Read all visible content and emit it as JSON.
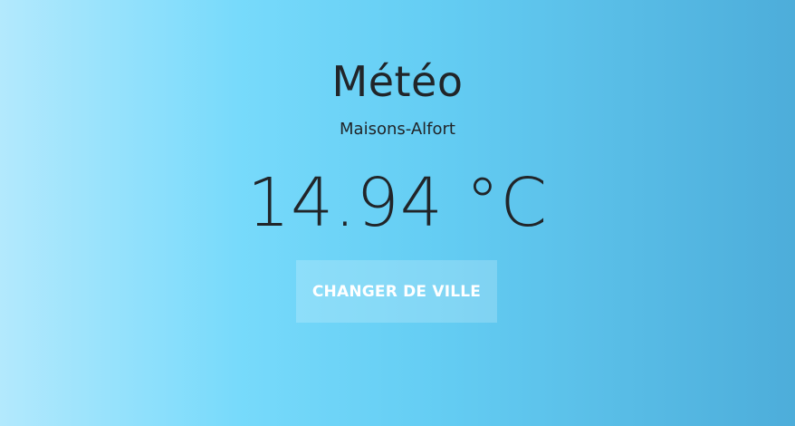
{
  "weather": {
    "title": "Météo",
    "city": "Maisons-Alfort",
    "temperature": "14.94 °C",
    "change_city_label": "CHANGER DE VILLE"
  },
  "colors": {
    "gradient_left": "#b3e9fd",
    "gradient_mid": "#64cdf3",
    "gradient_right": "#4dadda",
    "text": "#212529",
    "button_text": "#ffffff"
  }
}
